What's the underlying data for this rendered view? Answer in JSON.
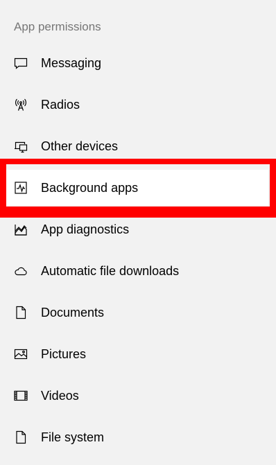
{
  "section": {
    "header": "App permissions"
  },
  "nav": {
    "items": [
      {
        "label": "Messaging",
        "icon": "chat-bubble-icon"
      },
      {
        "label": "Radios",
        "icon": "antenna-icon"
      },
      {
        "label": "Other devices",
        "icon": "devices-icon"
      },
      {
        "label": "Background apps",
        "icon": "activity-chart-icon",
        "highlighted": true
      },
      {
        "label": "App diagnostics",
        "icon": "area-chart-icon"
      },
      {
        "label": "Automatic file downloads",
        "icon": "cloud-icon"
      },
      {
        "label": "Documents",
        "icon": "document-icon"
      },
      {
        "label": "Pictures",
        "icon": "picture-icon"
      },
      {
        "label": "Videos",
        "icon": "film-icon"
      },
      {
        "label": "File system",
        "icon": "document-icon"
      }
    ]
  },
  "colors": {
    "highlight_border": "#ff0000",
    "background": "#f2f2f2",
    "header_text": "#767676"
  }
}
